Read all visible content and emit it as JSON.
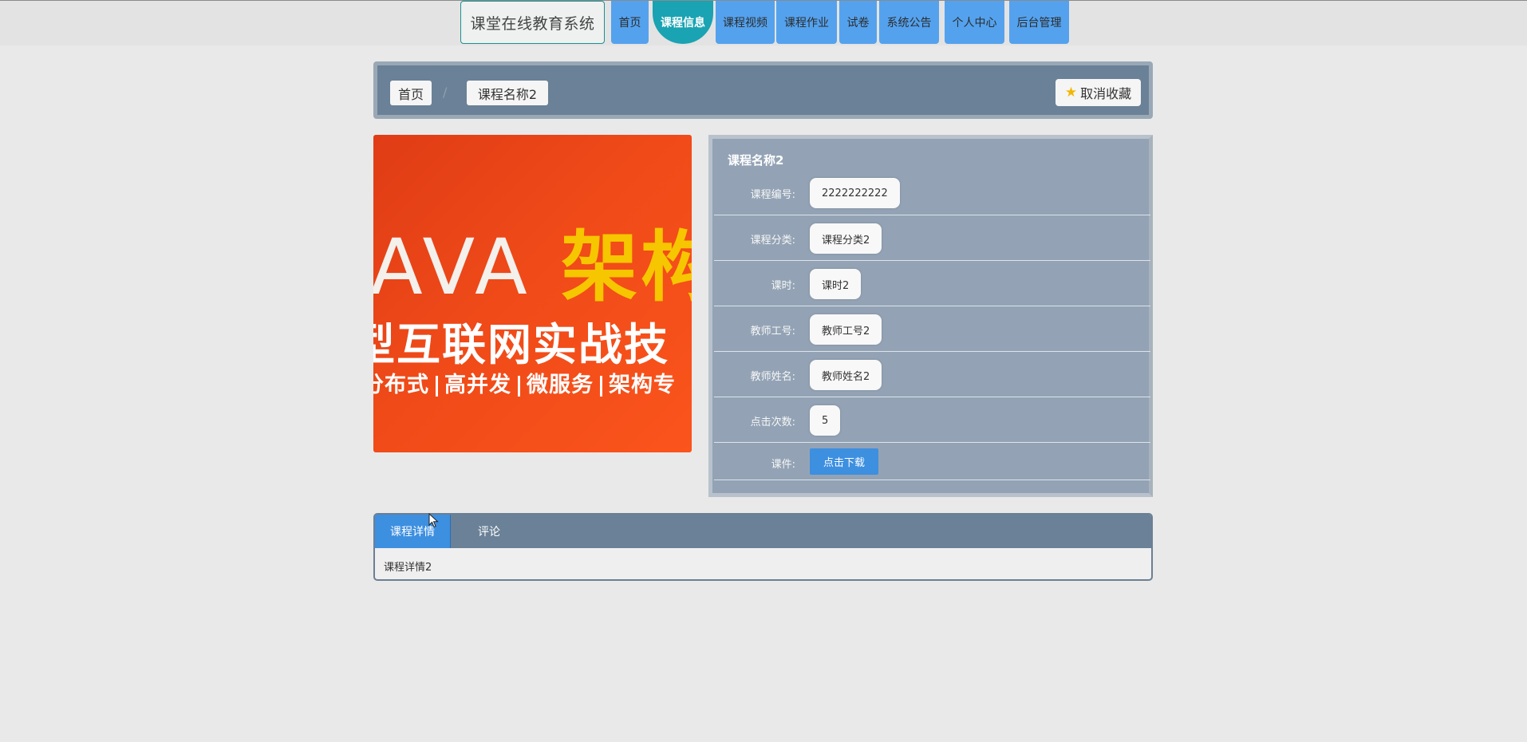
{
  "header": {
    "brand": "课堂在线教育系统",
    "nav": [
      "首页",
      "课程信息",
      "课程视频",
      "课程作业",
      "试卷",
      "系统公告",
      "个人中心",
      "后台管理"
    ],
    "active_nav": "课程信息"
  },
  "breadcrumb": {
    "home": "首页",
    "separator": "/",
    "current": "课程名称2",
    "favorite_button": "取消收藏"
  },
  "cover_image": {
    "line1_latin": "AVA",
    "line1_cn": "架构",
    "line2": "型互联网实战技",
    "line3": [
      "分布式",
      "高并发",
      "微服务",
      "架构专"
    ]
  },
  "detail": {
    "title": "课程名称2",
    "fields": [
      {
        "label": "课程编号:",
        "value": "2222222222"
      },
      {
        "label": "课程分类:",
        "value": "课程分类2"
      },
      {
        "label": "课时:",
        "value": "课时2"
      },
      {
        "label": "教师工号:",
        "value": "教师工号2"
      },
      {
        "label": "教师姓名:",
        "value": "教师姓名2"
      },
      {
        "label": "点击次数:",
        "value": "5"
      }
    ],
    "courseware_label": "课件:",
    "download_button": "点击下载"
  },
  "tabs": {
    "items": [
      "课程详情",
      "评论"
    ],
    "active": "课程详情",
    "content": "课程详情2"
  },
  "colors": {
    "nav_blue": "#54a2ee",
    "nav_active": "#1aa3b2",
    "panel_slate": "#6a8197",
    "detail_bg": "#93a3b5",
    "button_blue": "#3d8fe0"
  }
}
